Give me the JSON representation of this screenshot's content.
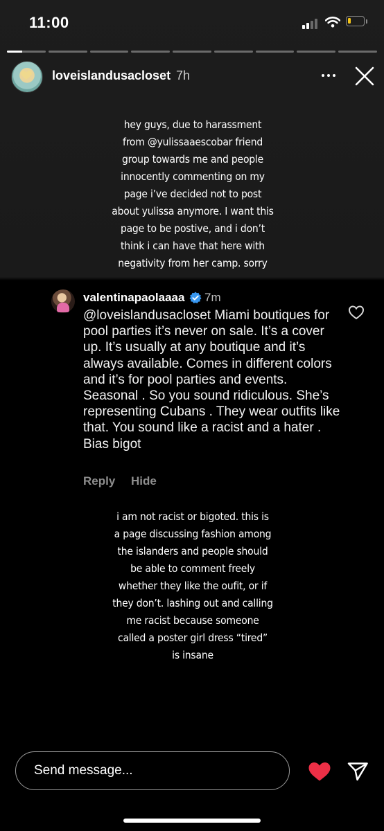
{
  "status_bar": {
    "time": "11:00",
    "signal_icon": "cellular-signal-icon",
    "wifi_icon": "wifi-icon",
    "battery_icon": "battery-icon",
    "battery_level": 0.2,
    "battery_color": "#f5c518"
  },
  "story": {
    "segments_total": 9,
    "segments_viewed": 1,
    "current_segment_progress": 0.4,
    "username": "loveislandusacloset",
    "time_ago": "7h",
    "more_icon": "more-horizontal-icon",
    "close_icon": "close-icon",
    "text_top": [
      "hey guys, due to harassment",
      "from @yulissaaescobar friend",
      "group towards me and people",
      "innocently commenting on my",
      "page i’ve decided not to post",
      "about yulissa anymore. I want this",
      "page to be postive, and i don’t",
      "think i can have that here with",
      "negativity from her camp. sorry"
    ],
    "text_bottom": [
      "i am not racist or bigoted. this is",
      "a page discussing fashion among",
      "the islanders and people should",
      "be able to comment freely",
      "whether they like the oufit, or if",
      "they don’t. lashing out and calling",
      "me racist because someone",
      "called a poster girl dress “tired”",
      "is insane"
    ]
  },
  "comment": {
    "username": "valentinapaolaaaa",
    "verified_icon": "verified-badge-icon",
    "verified_color": "#3897f0",
    "time_ago": "7m",
    "text": "@loveislandusacloset Miami boutiques for pool parties it’s never on sale. It’s a cover up. It’s usually at any boutique and it’s always available. Comes in different colors and it’s for pool parties and events. Seasonal . So you sound ridiculous. She’s representing Cubans . They wear outfits like that. You sound like a racist and a hater . Bias bigot",
    "like_icon": "heart-outline-icon",
    "reply_label": "Reply",
    "hide_label": "Hide"
  },
  "bottom_bar": {
    "message_placeholder": "Send message...",
    "heart_icon": "heart-filled-icon",
    "heart_color": "#ed2f46",
    "send_icon": "send-icon"
  }
}
